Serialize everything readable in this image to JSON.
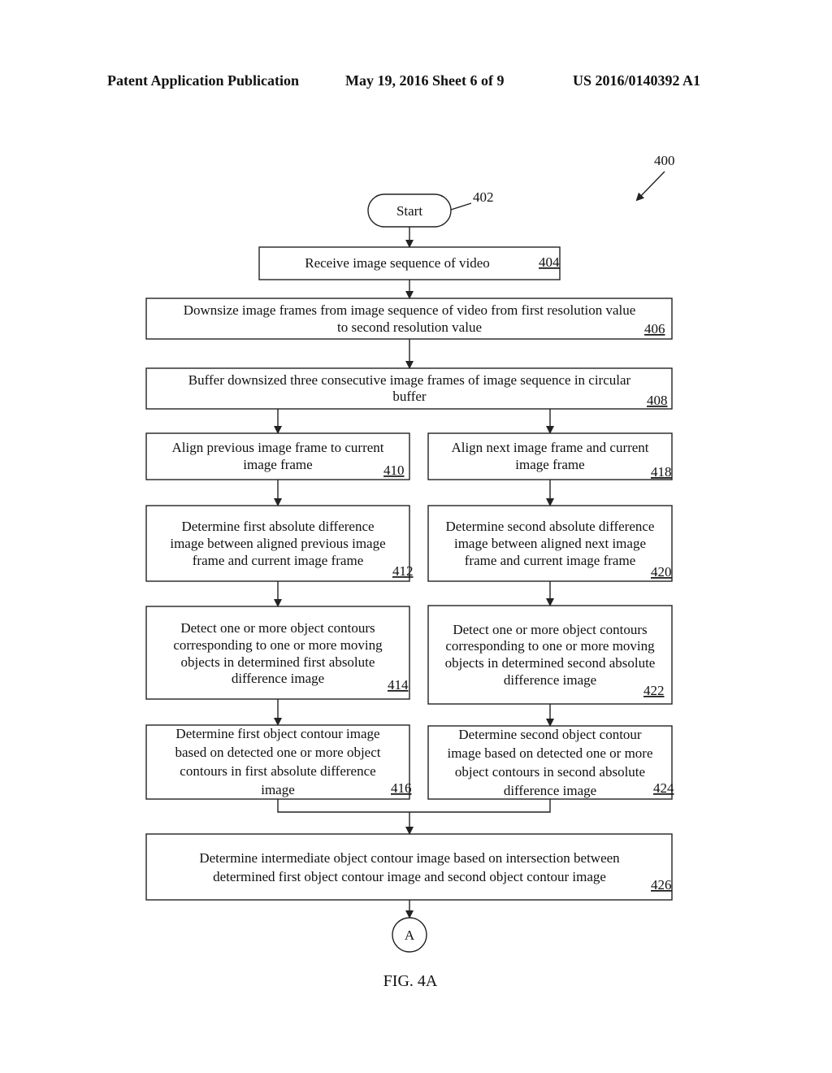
{
  "header": {
    "publication": "Patent Application Publication",
    "date_sheet": "May 19, 2016  Sheet 6 of 9",
    "patent_number": "US 2016/0140392 A1"
  },
  "figure": {
    "caption": "FIG. 4A",
    "ref": "400",
    "start": {
      "label": "Start",
      "ref": "402"
    },
    "connector": {
      "label": "A"
    },
    "steps": [
      {
        "id": "404",
        "lines": [
          "Receive image sequence of video"
        ]
      },
      {
        "id": "406",
        "lines": [
          "Downsize image frames from image sequence of video from first resolution value",
          "to second resolution value"
        ]
      },
      {
        "id": "408",
        "lines": [
          "Buffer downsized three consecutive image frames of image sequence in circular",
          "buffer"
        ]
      },
      {
        "id": "410",
        "lines": [
          "Align previous image frame to current",
          "image frame"
        ]
      },
      {
        "id": "412",
        "lines": [
          "Determine first absolute difference",
          "image between aligned previous image",
          "frame and current image frame"
        ]
      },
      {
        "id": "414",
        "lines": [
          "Detect one or more object contours",
          "corresponding to one or more moving",
          "objects in determined first absolute",
          "difference image"
        ]
      },
      {
        "id": "416",
        "lines": [
          "Determine first object contour image",
          "based on detected one or more object",
          "contours in first absolute difference",
          "image"
        ]
      },
      {
        "id": "418",
        "lines": [
          "Align next image frame and current",
          "image frame"
        ]
      },
      {
        "id": "420",
        "lines": [
          "Determine second absolute difference",
          "image between aligned next image",
          "frame and current image frame"
        ]
      },
      {
        "id": "422",
        "lines": [
          "Detect one or more object contours",
          "corresponding to one or more moving",
          "objects in determined second absolute",
          "difference image"
        ]
      },
      {
        "id": "424",
        "lines": [
          "Determine second object contour",
          "image based on detected one or more",
          "object contours in second absolute",
          "difference image"
        ]
      },
      {
        "id": "426",
        "lines": [
          "Determine intermediate object contour image based on intersection between",
          "determined first object contour image and second object contour image"
        ]
      }
    ]
  }
}
